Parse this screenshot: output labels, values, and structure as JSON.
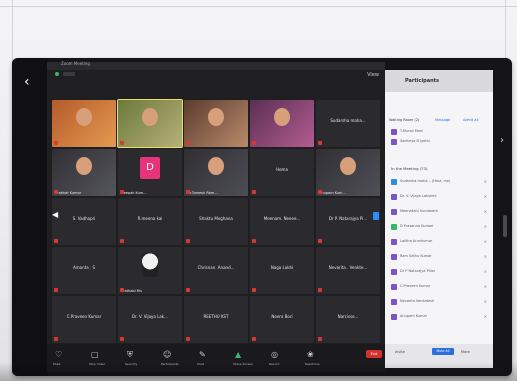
{
  "window": {
    "title": "Zoom Meeting"
  },
  "meeting": {
    "view_label": "View",
    "tiles": [
      {
        "name": "",
        "caption": "",
        "kind": "video-orange"
      },
      {
        "name": "",
        "caption": "",
        "kind": "video-woman"
      },
      {
        "name": "",
        "caption": "",
        "kind": "video-man"
      },
      {
        "name": "",
        "caption": "",
        "kind": "video-woman2"
      },
      {
        "name": "Sudarsha maha...",
        "caption": "",
        "kind": "text"
      },
      {
        "name": "",
        "caption": "Prabhat Kumar",
        "kind": "video-man2"
      },
      {
        "name": "D",
        "caption": "Deepak Kum...",
        "kind": "avatar-D"
      },
      {
        "name": "",
        "caption": "Dr.Tomesh Ram...",
        "kind": "video-man3"
      },
      {
        "name": "Hema",
        "caption": "",
        "kind": "text"
      },
      {
        "name": "",
        "caption": "Anupam Kum...",
        "kind": "video-man4"
      },
      {
        "name": "S. Vadhapri",
        "caption": "",
        "kind": "text"
      },
      {
        "name": "R.meena kai",
        "caption": "",
        "kind": "text"
      },
      {
        "name": "Shaktu Meghana",
        "caption": "",
        "kind": "text"
      },
      {
        "name": "Meenam. Neeee...",
        "caption": "",
        "kind": "text"
      },
      {
        "name": "Dr P. Natarajya Pi...",
        "caption": "",
        "kind": "text"
      },
      {
        "name": "Amanta . S",
        "caption": "",
        "kind": "text"
      },
      {
        "name": "",
        "caption": "Prathabi Ris",
        "kind": "avatar-dj"
      },
      {
        "name": "Chrisnan. Anand...",
        "caption": "",
        "kind": "text"
      },
      {
        "name": "Naga Lakhi",
        "caption": "",
        "kind": "text"
      },
      {
        "name": "Nevarita . Venkte...",
        "caption": "",
        "kind": "text"
      },
      {
        "name": "C.Praveen Kumar",
        "caption": "",
        "kind": "text"
      },
      {
        "name": "Dr. V. Vijaya Lak...",
        "caption": "",
        "kind": "text"
      },
      {
        "name": "REETHU KST",
        "caption": "",
        "kind": "text"
      },
      {
        "name": "Neera Bori",
        "caption": "",
        "kind": "text"
      },
      {
        "name": "Narcisse...",
        "caption": "",
        "kind": "text"
      }
    ]
  },
  "toolbar": {
    "items": [
      {
        "icon": "mic-icon",
        "label": "Mute"
      },
      {
        "icon": "video-icon",
        "label": "Stop Video"
      },
      {
        "icon": "shield-icon",
        "label": "Security"
      },
      {
        "icon": "participants-icon",
        "label": "Participants"
      },
      {
        "icon": "chat-icon",
        "label": "Chat"
      },
      {
        "icon": "share-icon",
        "label": "Share Screen"
      },
      {
        "icon": "record-icon",
        "label": "Record"
      },
      {
        "icon": "reactions-icon",
        "label": "Reactions"
      }
    ],
    "leave_label": "End"
  },
  "panel": {
    "title": "Participants",
    "tab_waiting": "Waiting Room (2)",
    "tab_message": "Message",
    "tab_admit": "Admit all",
    "waiting": [
      {
        "name": "T.Murali Mani",
        "color": "#7a55c9"
      },
      {
        "name": "Sadhriya B Jyothi",
        "color": "#7a55c9"
      }
    ],
    "in_meeting_label": "In the Meeting (73)",
    "members": [
      {
        "name": "Sudarsha maha... (Host, me)",
        "color": "#2f8fdb"
      },
      {
        "name": "Dr. V. Vijaya Lakshmi",
        "color": "#7a55c9"
      },
      {
        "name": "Meenakshi Sundaram",
        "color": "#7a55c9"
      },
      {
        "name": "D Prasanna Kumari",
        "color": "#3bb56b"
      },
      {
        "name": "Lalitha Arunkumar",
        "color": "#7a55c9"
      },
      {
        "name": "Ram Sethu Kumar",
        "color": "#7a55c9"
      },
      {
        "name": "Dr P Natarajya Pillai",
        "color": "#7a55c9"
      },
      {
        "name": "C.Praveen Kumar",
        "color": "#7a55c9"
      },
      {
        "name": "Nevarita Venkatesh",
        "color": "#7a55c9"
      },
      {
        "name": "Anupam Kumar",
        "color": "#7a55c9"
      }
    ],
    "footer_invite": "Invite",
    "footer_mute_all": "Mute All",
    "footer_more": "More"
  }
}
